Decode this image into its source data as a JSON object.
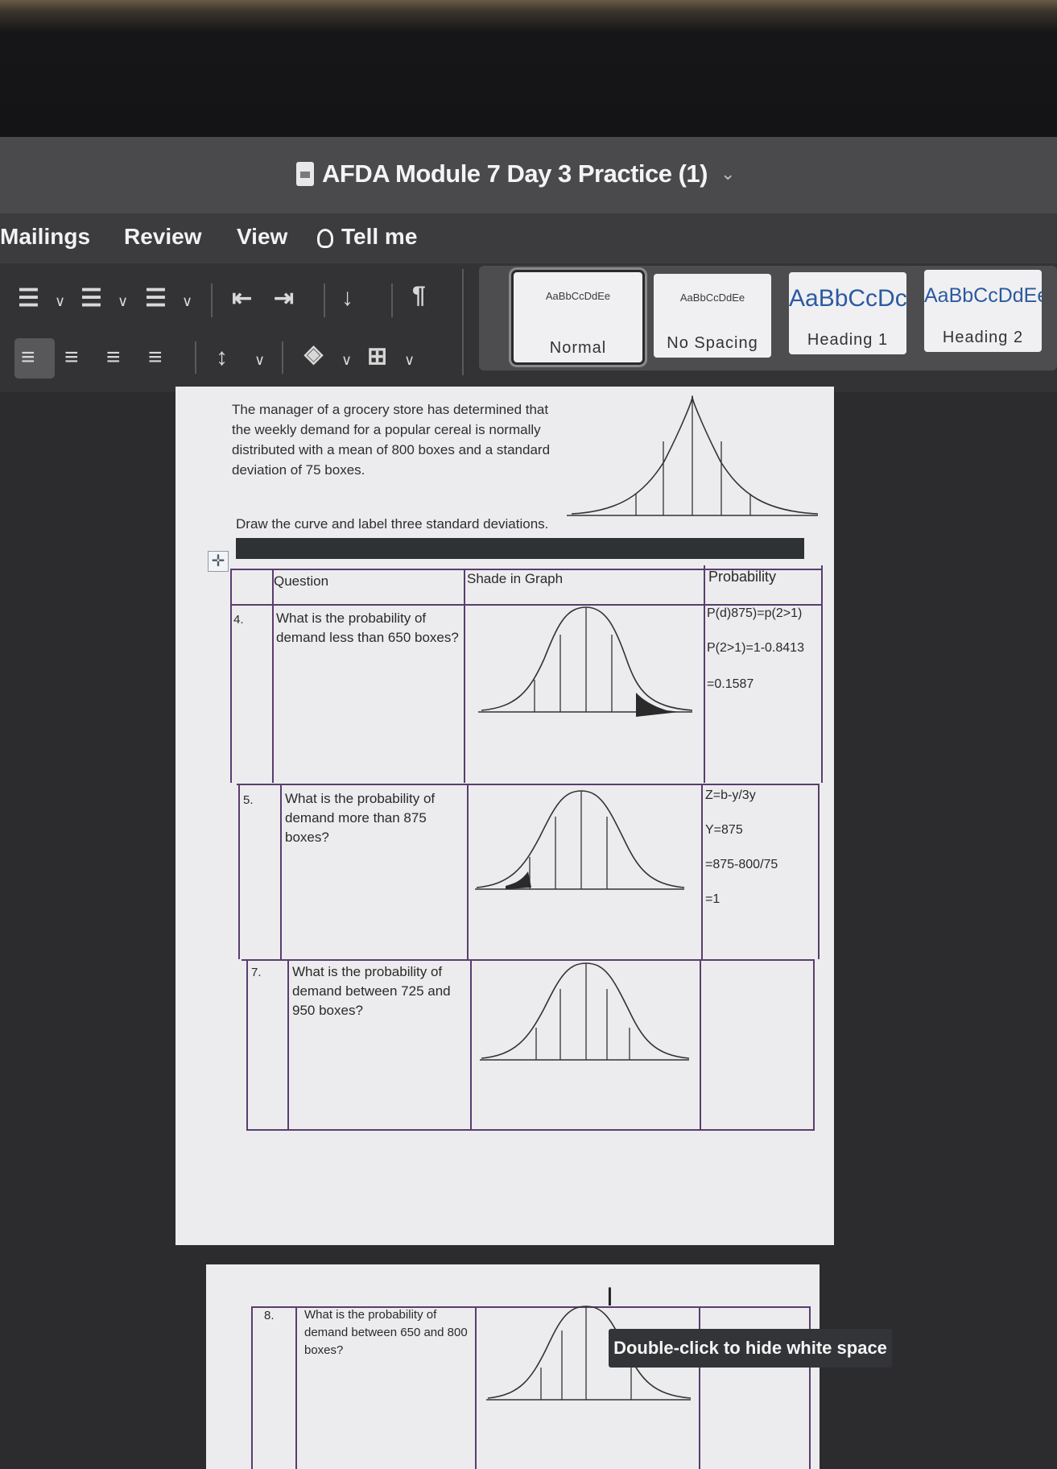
{
  "window": {
    "title": "AFDA Module 7 Day 3 Practice (1)"
  },
  "menu": {
    "mailings": "Mailings",
    "review": "Review",
    "view": "View",
    "tell_me": "Tell me"
  },
  "styles": [
    {
      "sample": "AaBbCcDdEe",
      "name": "Normal"
    },
    {
      "sample": "AaBbCcDdEe",
      "name": "No Spacing"
    },
    {
      "sample": "AaBbCcDc",
      "name": "Heading 1"
    },
    {
      "sample": "AaBbCcDdEe",
      "name": "Heading 2"
    }
  ],
  "document": {
    "intro": "The manager of a grocery store has determined that the weekly demand for a popular cereal is normally distributed with a mean of 800 boxes and a standard deviation of 75 boxes.",
    "instruction": "Draw the curve and label three standard deviations.",
    "table_headers": {
      "question": "Question",
      "shade": "Shade in Graph",
      "probability": "Probability"
    },
    "rows": [
      {
        "number": "4.",
        "question": "What is the probability of demand less than 650 boxes?",
        "answers": [
          "P(d)875)=p(2>1)",
          "P(2>1)=1-0.8413",
          "=0.1587"
        ]
      },
      {
        "number": "5.",
        "question": "What is the probability of demand more than 875 boxes?",
        "answers": [
          "Z=b-y/3y",
          "Y=875",
          "=875-800/75",
          "=1"
        ]
      },
      {
        "number": "7.",
        "question": "What is the probability of demand between 725 and 950 boxes?",
        "answers": []
      }
    ],
    "page2_row": {
      "number": "8.",
      "question": "What is the probability of demand between 650 and 800 boxes?"
    }
  },
  "tooltip": "Double-click to hide white space"
}
